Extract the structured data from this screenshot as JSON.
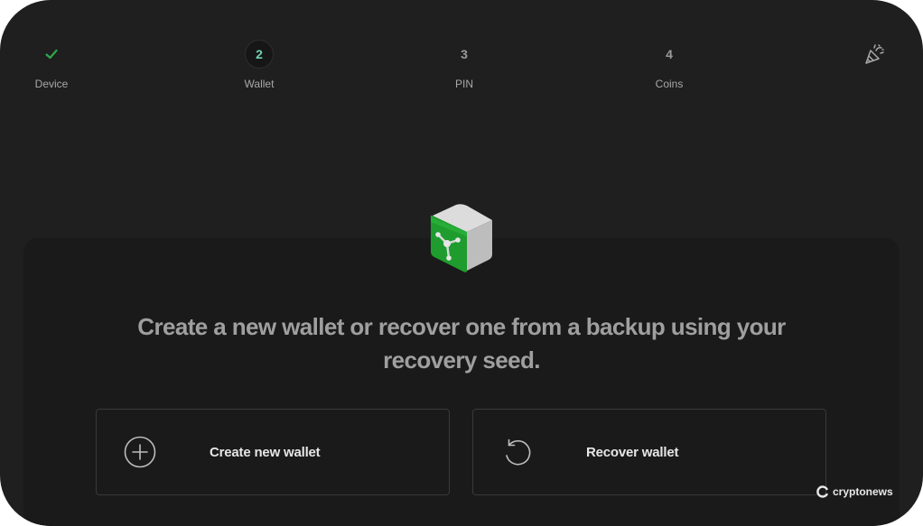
{
  "stepper": {
    "steps": [
      {
        "marker": "",
        "label": "Device",
        "state": "completed"
      },
      {
        "marker": "2",
        "label": "Wallet",
        "state": "active"
      },
      {
        "marker": "3",
        "label": "PIN",
        "state": "pending"
      },
      {
        "marker": "4",
        "label": "Coins",
        "state": "pending"
      }
    ],
    "completed_icon": "checkmark-icon",
    "finish_icon": "party-popper-icon"
  },
  "main": {
    "illustration": "safe-icon",
    "headline": "Create a new wallet or recover one from a backup using your recovery seed.",
    "options": [
      {
        "label": "Create new wallet",
        "icon": "plus-circle-icon"
      },
      {
        "label": "Recover wallet",
        "icon": "rotate-ccw-icon"
      }
    ]
  },
  "watermark": {
    "text": "cryptonews"
  },
  "colors": {
    "background": "#1f1f1f",
    "card": "#1a1a1a",
    "accent_green": "#2ea84a",
    "active_step_text": "#6fd3b0",
    "border": "#393939"
  }
}
